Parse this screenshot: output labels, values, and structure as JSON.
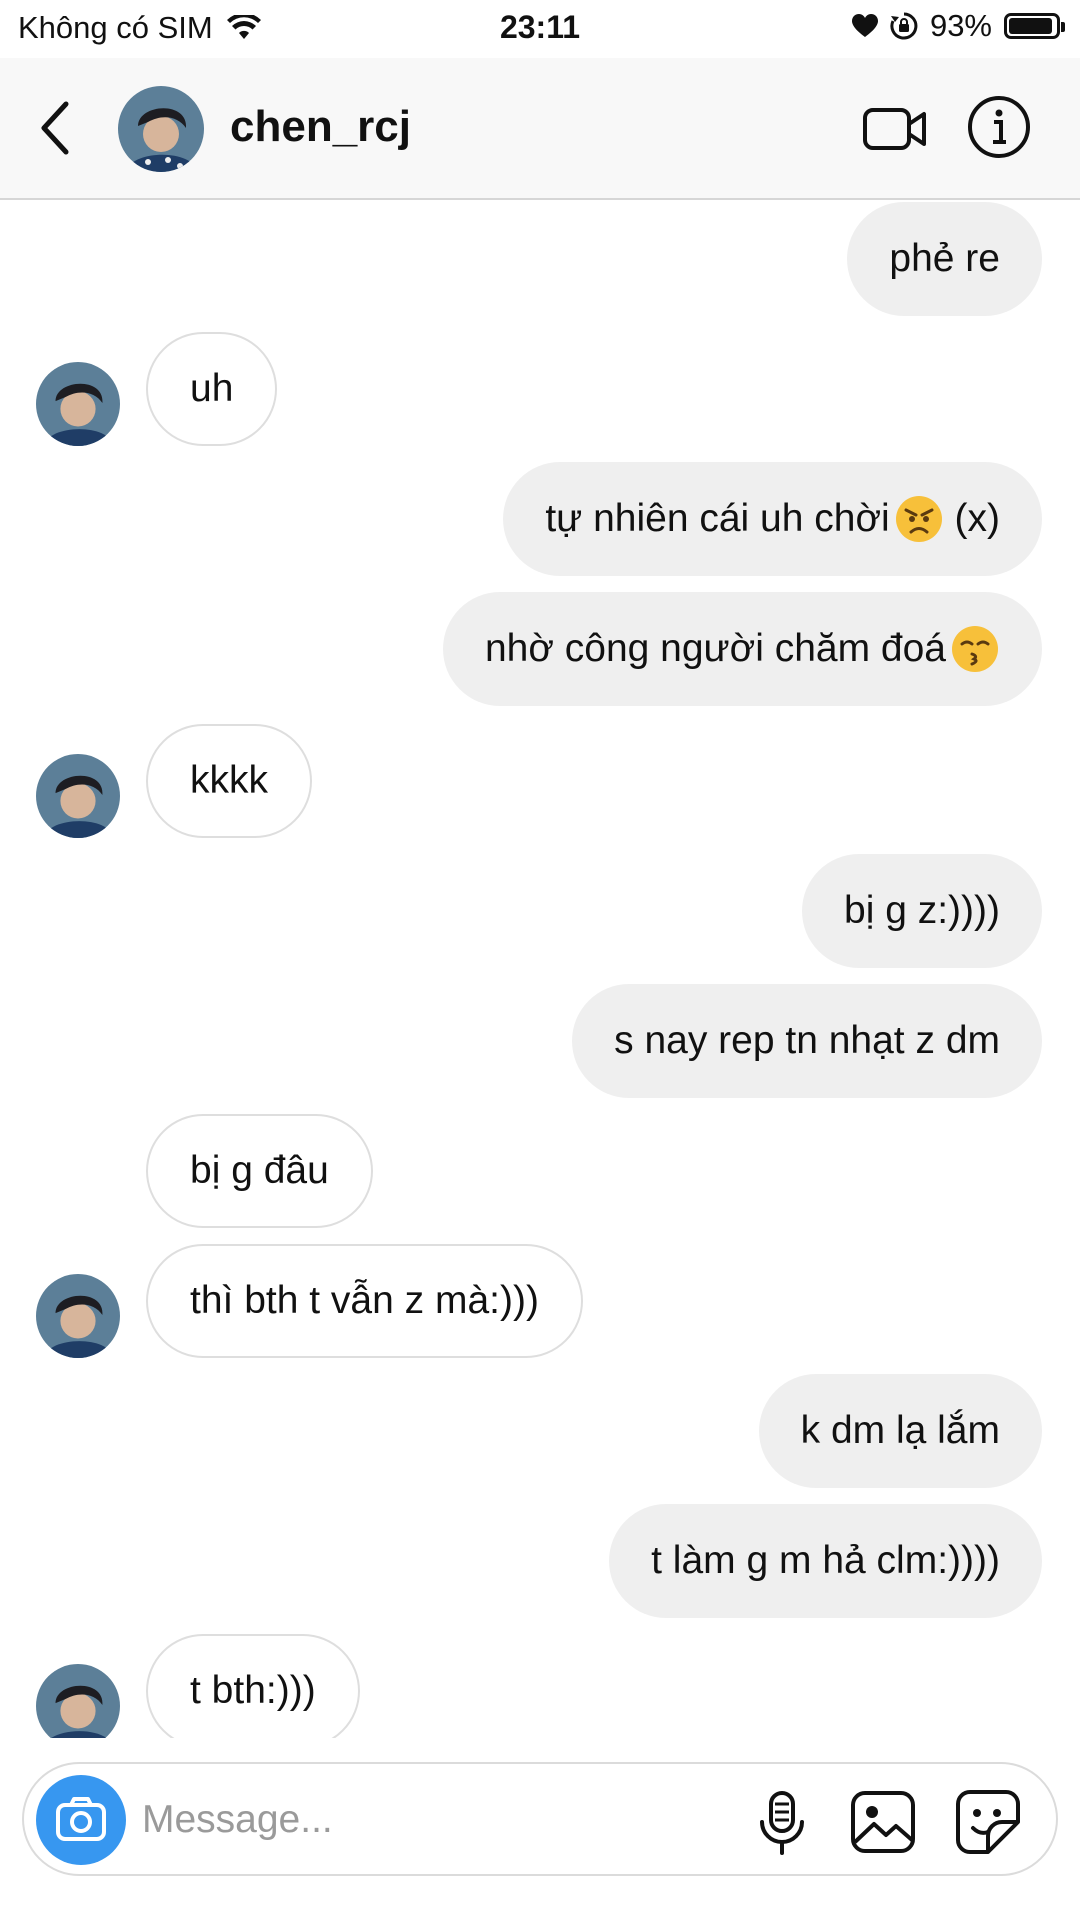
{
  "status_bar": {
    "carrier": "Không có SIM",
    "time": "23:11",
    "battery": "93%",
    "battery_level": 0.93
  },
  "header": {
    "username": "chen_rcj",
    "avatar_icon": "profile-photo"
  },
  "messages": [
    {
      "side": "sent",
      "text": "phẻ re"
    },
    {
      "side": "recv",
      "text": "uh",
      "avatar": true
    },
    {
      "side": "sent",
      "text": "tự nhiên cái uh chời",
      "emoji": "angry-face",
      "after": " (x)"
    },
    {
      "side": "sent",
      "text": "nhờ công người chăm đoá",
      "emoji": "kissing-face"
    },
    {
      "side": "recv",
      "text": "kkkk",
      "avatar": true
    },
    {
      "side": "sent",
      "text": "bị g z:))))"
    },
    {
      "side": "sent",
      "text": "s nay rep tn nhạt z dm"
    },
    {
      "side": "recv",
      "text": "bị g đâu",
      "avatar": false
    },
    {
      "side": "recv",
      "text": "thì bth t vẫn z mà:)))",
      "avatar": true
    },
    {
      "side": "sent",
      "text": "k dm lạ lắm"
    },
    {
      "side": "sent",
      "text": "t làm g m hả clm:))))"
    },
    {
      "side": "recv",
      "text": "t bth:)))",
      "avatar": true
    }
  ],
  "composer": {
    "placeholder": "Message..."
  },
  "colors": {
    "accent": "#3797f0",
    "sent_bubble": "#efefef",
    "header_bg": "#f8f8f8"
  }
}
